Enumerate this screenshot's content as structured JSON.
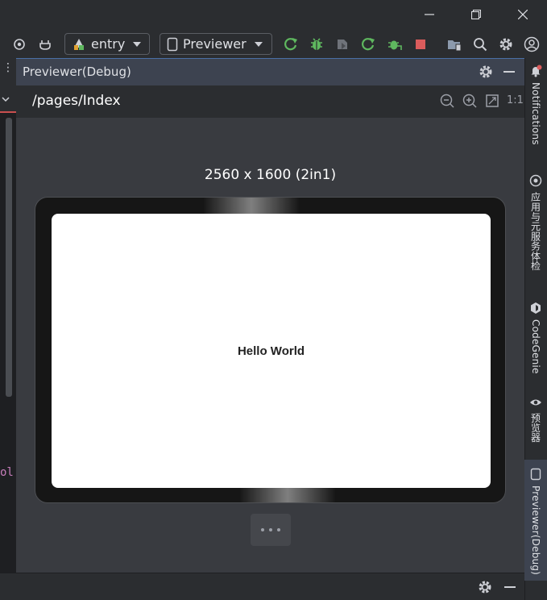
{
  "toolbar": {
    "run_config": "entry",
    "device_selector": "Previewer"
  },
  "panel": {
    "title": "Previewer(Debug)",
    "path": "/pages/Index",
    "zoom_ratio": "1:1"
  },
  "preview": {
    "resolution_label": "2560 x 1600 (2in1)",
    "content_text": "Hello World"
  },
  "editor_fragment": "ol",
  "right_sidebar": {
    "tabs": [
      "Notifications",
      "应用与元服务体检",
      "CodeGenie",
      "预览器",
      "Previewer(Debug)"
    ]
  },
  "colors": {
    "accent_green": "#5fb85f",
    "stop_red": "#db5c5c",
    "toolbar_bg": "#2b2d30",
    "panel_header_bg": "#3d4350"
  }
}
